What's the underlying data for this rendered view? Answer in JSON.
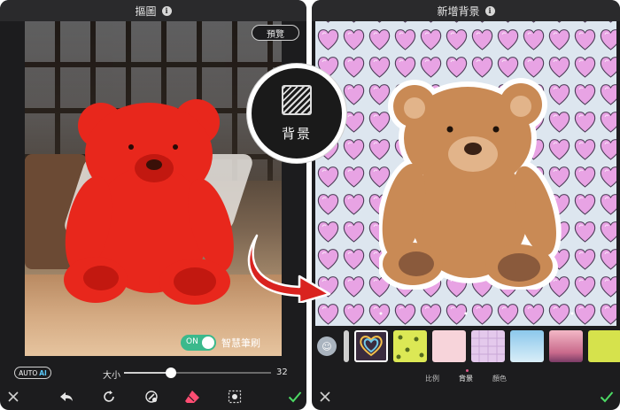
{
  "left_screen": {
    "title": "摳圖",
    "info_icon": "info-icon",
    "preview_button": "預覽",
    "smart_toggle": {
      "state_label": "ON",
      "label": "智慧筆刷",
      "enabled": true
    },
    "auto_ai": {
      "prefix": "AUTO",
      "suffix": "AI"
    },
    "brush_size": {
      "label": "大小",
      "value": "32",
      "level_fraction": 0.32
    },
    "toolbar_icons": [
      "close-icon",
      "undo-icon",
      "redo-icon",
      "brush-restore-icon",
      "eraser-icon",
      "selection-icon",
      "confirm-check-icon"
    ]
  },
  "zoom_callout": {
    "label": "背景",
    "icon": "background-pattern-icon"
  },
  "right_screen": {
    "title": "新增背景",
    "info_icon": "info-icon",
    "bottom_tabs": [
      {
        "label": "比例",
        "active": false
      },
      {
        "label": "背景",
        "active": true
      },
      {
        "label": "顏色",
        "active": false
      }
    ],
    "thumbnails": [
      "avatar-thumbnail",
      "striped-thumbnail",
      "rainbow-heart-thumbnail",
      "lime-pattern-thumbnail",
      "pink-dots-thumbnail",
      "lavender-grid-thumbnail",
      "sky-clouds-thumbnail",
      "pink-gradient-thumbnail",
      "yellow-green-thumbnail"
    ],
    "toolbar_icons": [
      "close-icon",
      "confirm-check-icon"
    ]
  },
  "colors": {
    "app_dark": "#1c1c1e",
    "title_bar": "#2a2a2c",
    "toggle_green": "#3bb98c",
    "heart_pink": "#e8a3e4",
    "accent_red": "#d9231f",
    "check_green": "#4cd964",
    "eraser_pink": "#ff4d73"
  }
}
